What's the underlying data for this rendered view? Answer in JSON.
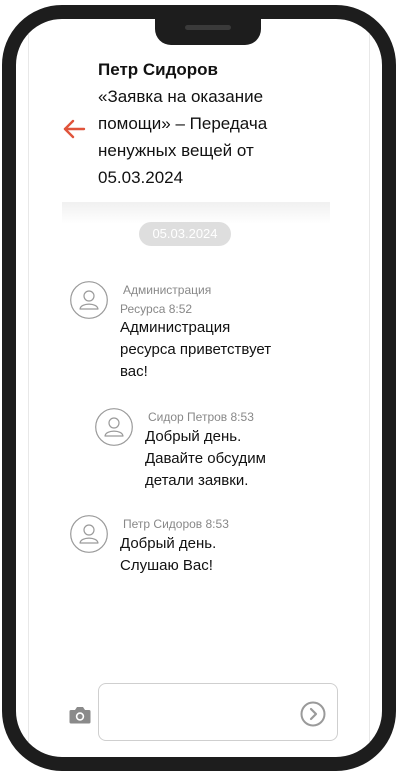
{
  "header": {
    "contact_name": "Петр Сидоров",
    "subject": "«Заявка на оказание помощи» – Передача ненужных вещей от 05.03.2024"
  },
  "chat": {
    "date_separator": "05.03.2024",
    "messages": [
      {
        "author_time": "Администрация Ресурса 8:52",
        "text": "Администрация ресурса приветствует вас!"
      },
      {
        "author_time": "Сидор Петров 8:53",
        "text": "Добрый день. Давайте обсудим детали заявки."
      },
      {
        "author_time": "Петр Сидоров 8:53",
        "text": "Добрый день. Слушаю Вас!"
      }
    ]
  },
  "composer": {
    "placeholder": "",
    "camera_icon": "camera-icon",
    "send_icon": "send-icon"
  },
  "colors": {
    "accent": "#e0543b",
    "frame": "#1d1d1d",
    "muted_text": "#888888",
    "date_badge": "#dedede"
  }
}
